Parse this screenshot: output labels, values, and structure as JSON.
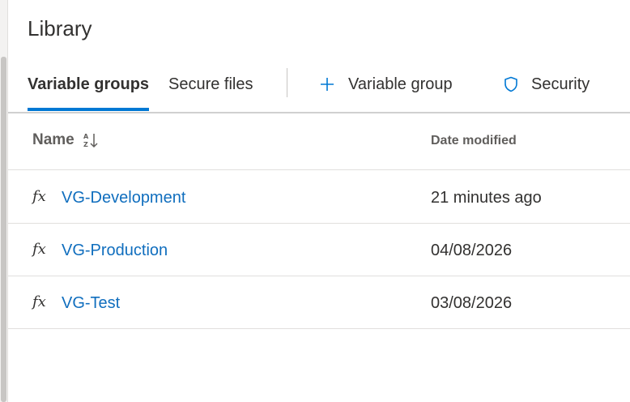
{
  "page": {
    "title": "Library"
  },
  "tabs": [
    {
      "label": "Variable groups",
      "selected": true
    },
    {
      "label": "Secure files",
      "selected": false
    }
  ],
  "commands": {
    "add_variable_group": {
      "label": "Variable group",
      "icon": "plus-icon"
    },
    "security": {
      "label": "Security",
      "icon": "shield-icon"
    }
  },
  "table": {
    "columns": {
      "name": "Name",
      "date_modified": "Date modified"
    },
    "sort_icon": "sort-az-icon",
    "rows": [
      {
        "icon": "fx-icon",
        "icon_text": "fx",
        "name": "VG-Development",
        "date": "21 minutes ago"
      },
      {
        "icon": "fx-icon",
        "icon_text": "fx",
        "name": "VG-Production",
        "date": "04/08/2026"
      },
      {
        "icon": "fx-icon",
        "icon_text": "fx",
        "name": "VG-Test",
        "date": "03/08/2026"
      }
    ]
  },
  "colors": {
    "accent": "#0078d4",
    "link": "#106ebe",
    "text": "#323130",
    "muted": "#605e5c"
  }
}
